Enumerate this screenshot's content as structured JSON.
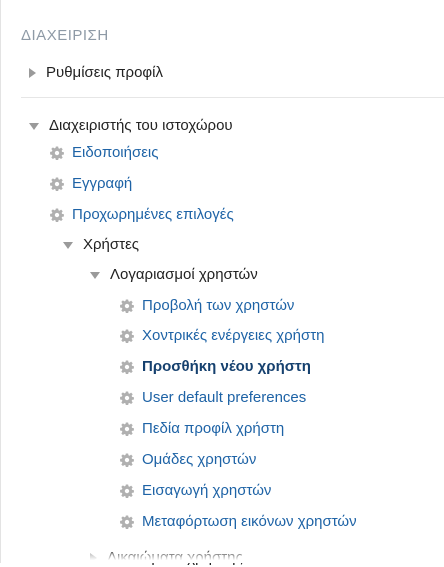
{
  "panel": {
    "header": "ΔΙΑΧΕΙΡΙΣΗ",
    "profile_settings": "Ρυθμίσεις προφίλ",
    "site_admin": {
      "label": "Διαχειριστής του ιστοχώρου",
      "items": [
        "Ειδοποιήσεις",
        "Εγγραφή",
        "Προχωρημένες επιλογές"
      ],
      "users": {
        "label": "Χρήστες",
        "accounts": {
          "label": "Λογαριασμοί χρηστών",
          "items": [
            "Προβολή των χρηστών",
            "Χοντρικές ενέργειες χρήστη",
            "Προσθήκη νέου χρήστη",
            "User default preferences",
            "Πεδία προφίλ χρήστη",
            "Ομάδες χρηστών",
            "Εισαγωγή χρηστών",
            "Μεταφόρτωση εικόνων χρηστών"
          ],
          "active_item": "Προσθήκη νέου χρήστη"
        },
        "next_section_partial": "Δικαιώματα χρήστης"
      }
    }
  },
  "colors": {
    "link": "#1e63a6",
    "active": "#16416f",
    "header": "#8e9aa6",
    "icon_gear": "#b0b0b0",
    "arrow": "#9a9a9a"
  },
  "icons": {
    "collapsed": "triangle-right-icon",
    "expanded": "triangle-down-icon",
    "item": "gear-icon"
  }
}
